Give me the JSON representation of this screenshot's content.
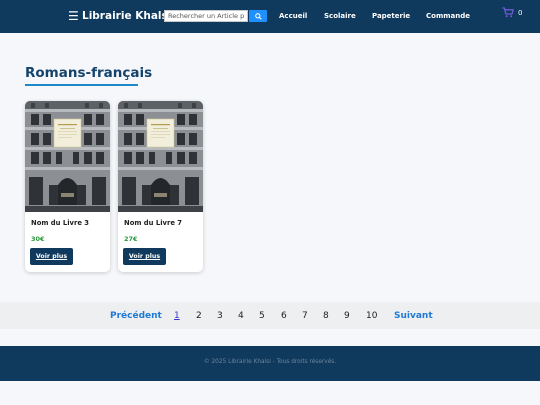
{
  "header": {
    "brand": "Librairie Khalsi",
    "search_placeholder": "Rechercher un Article par",
    "nav": [
      "Accueil",
      "Scolaire",
      "Papeterie",
      "Commande"
    ],
    "cart_count": "0"
  },
  "section": {
    "title": "Romans-français"
  },
  "products": [
    {
      "name": "Nom du Livre 3",
      "price": "30€",
      "button": "Voir plus"
    },
    {
      "name": "Nom du Livre 7",
      "price": "27€",
      "button": "Voir plus"
    }
  ],
  "pagination": {
    "prev": "Précédent",
    "pages": [
      "1",
      "2",
      "3",
      "4",
      "5",
      "6",
      "7",
      "8",
      "9",
      "10"
    ],
    "current": "1",
    "next": "Suivant"
  },
  "footer": {
    "text": "© 2025 Librairie Khalsi - Tous droits réservés."
  },
  "colors": {
    "header_bg": "#0f3a5e",
    "accent": "#1e88c9",
    "price": "#2a9a3b",
    "search_button": "#1e90ff",
    "page_nav": "#1e7ad6"
  },
  "icons": {
    "menu": "hamburger-icon",
    "search": "search-icon",
    "cart": "cart-icon"
  }
}
